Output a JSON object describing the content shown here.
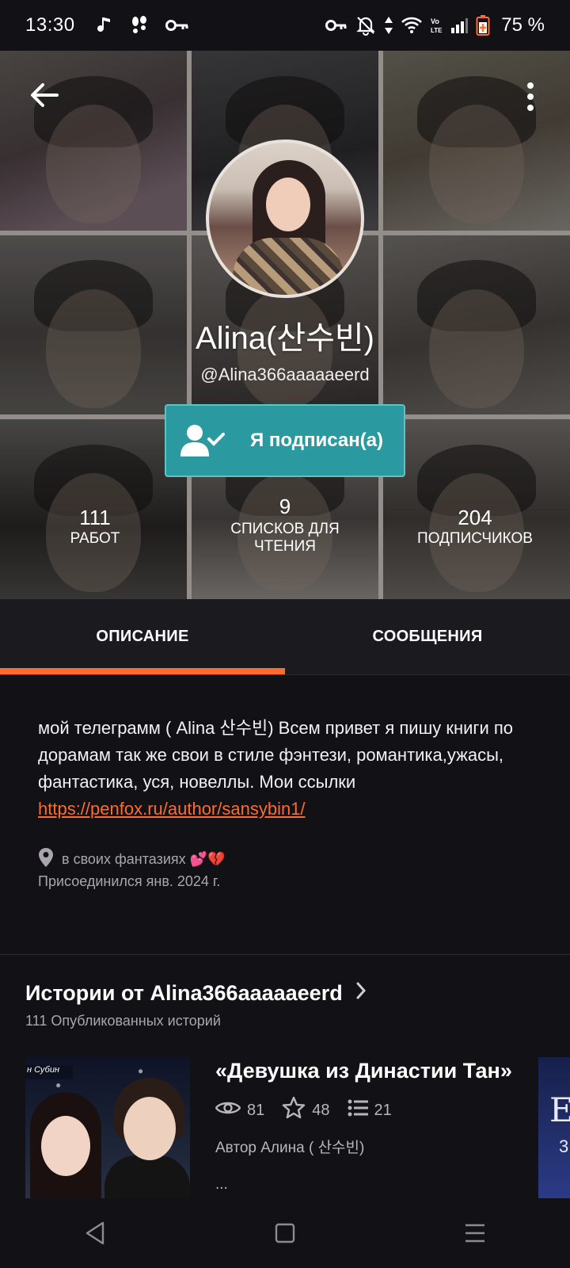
{
  "status_bar": {
    "time": "13:30",
    "battery": "75 %",
    "left_icons": [
      "music-note-icon",
      "footprints-icon",
      "key-icon"
    ],
    "right_icons": [
      "key-icon",
      "bell-off-icon",
      "data-arrows-icon",
      "wifi-icon",
      "volte-icon",
      "signal-icon",
      "battery-icon"
    ]
  },
  "header": {
    "back_icon": "arrow-left-icon",
    "more_icon": "more-vertical-icon"
  },
  "profile": {
    "name": "Alina(산수빈)",
    "handle": "@Alina366aaaaaeerd",
    "follow_button": "Я подписан(а)"
  },
  "stats": [
    {
      "value": "111",
      "label": "РАБОТ"
    },
    {
      "value": "9",
      "label": "СПИСКОВ ДЛЯ ЧТЕНИЯ"
    },
    {
      "value": "204",
      "label": "ПОДПИСЧИКОВ"
    }
  ],
  "tabs": [
    {
      "label": "ОПИСАНИЕ",
      "active": true
    },
    {
      "label": "СООБЩЕНИЯ",
      "active": false
    }
  ],
  "about": {
    "text": "мой телеграмм ( Alina 산수빈) Всем привет я пишу книги по дорамам так же свои в стиле фэнтези, романтика,ужасы, фантастика, уся, новеллы. Мои ссылки ",
    "link": "https://penfox.ru/author/sansybin1/",
    "location": "в своих фантазиях 💕💔",
    "joined": "Присоединился янв. 2024 г."
  },
  "stories": {
    "title": "Истории от Alina366aaaaaeerd",
    "subtitle": "111 Опубликованных историй",
    "items": [
      {
        "title": "«Девушка из Династии Тан»",
        "cover_banner": "н Субин",
        "views": "81",
        "votes": "48",
        "parts": "21",
        "author": "Автор Алина ( 산수빈)",
        "description": "..."
      }
    ],
    "next_cover_text": [
      "E",
      "3"
    ]
  },
  "navbar": {
    "items": [
      "back-triangle-icon",
      "home-square-icon",
      "menu-lines-icon"
    ]
  },
  "colors": {
    "accent": "#ff6b2c",
    "follow_button": "#2b9aa0",
    "background": "#121115"
  }
}
